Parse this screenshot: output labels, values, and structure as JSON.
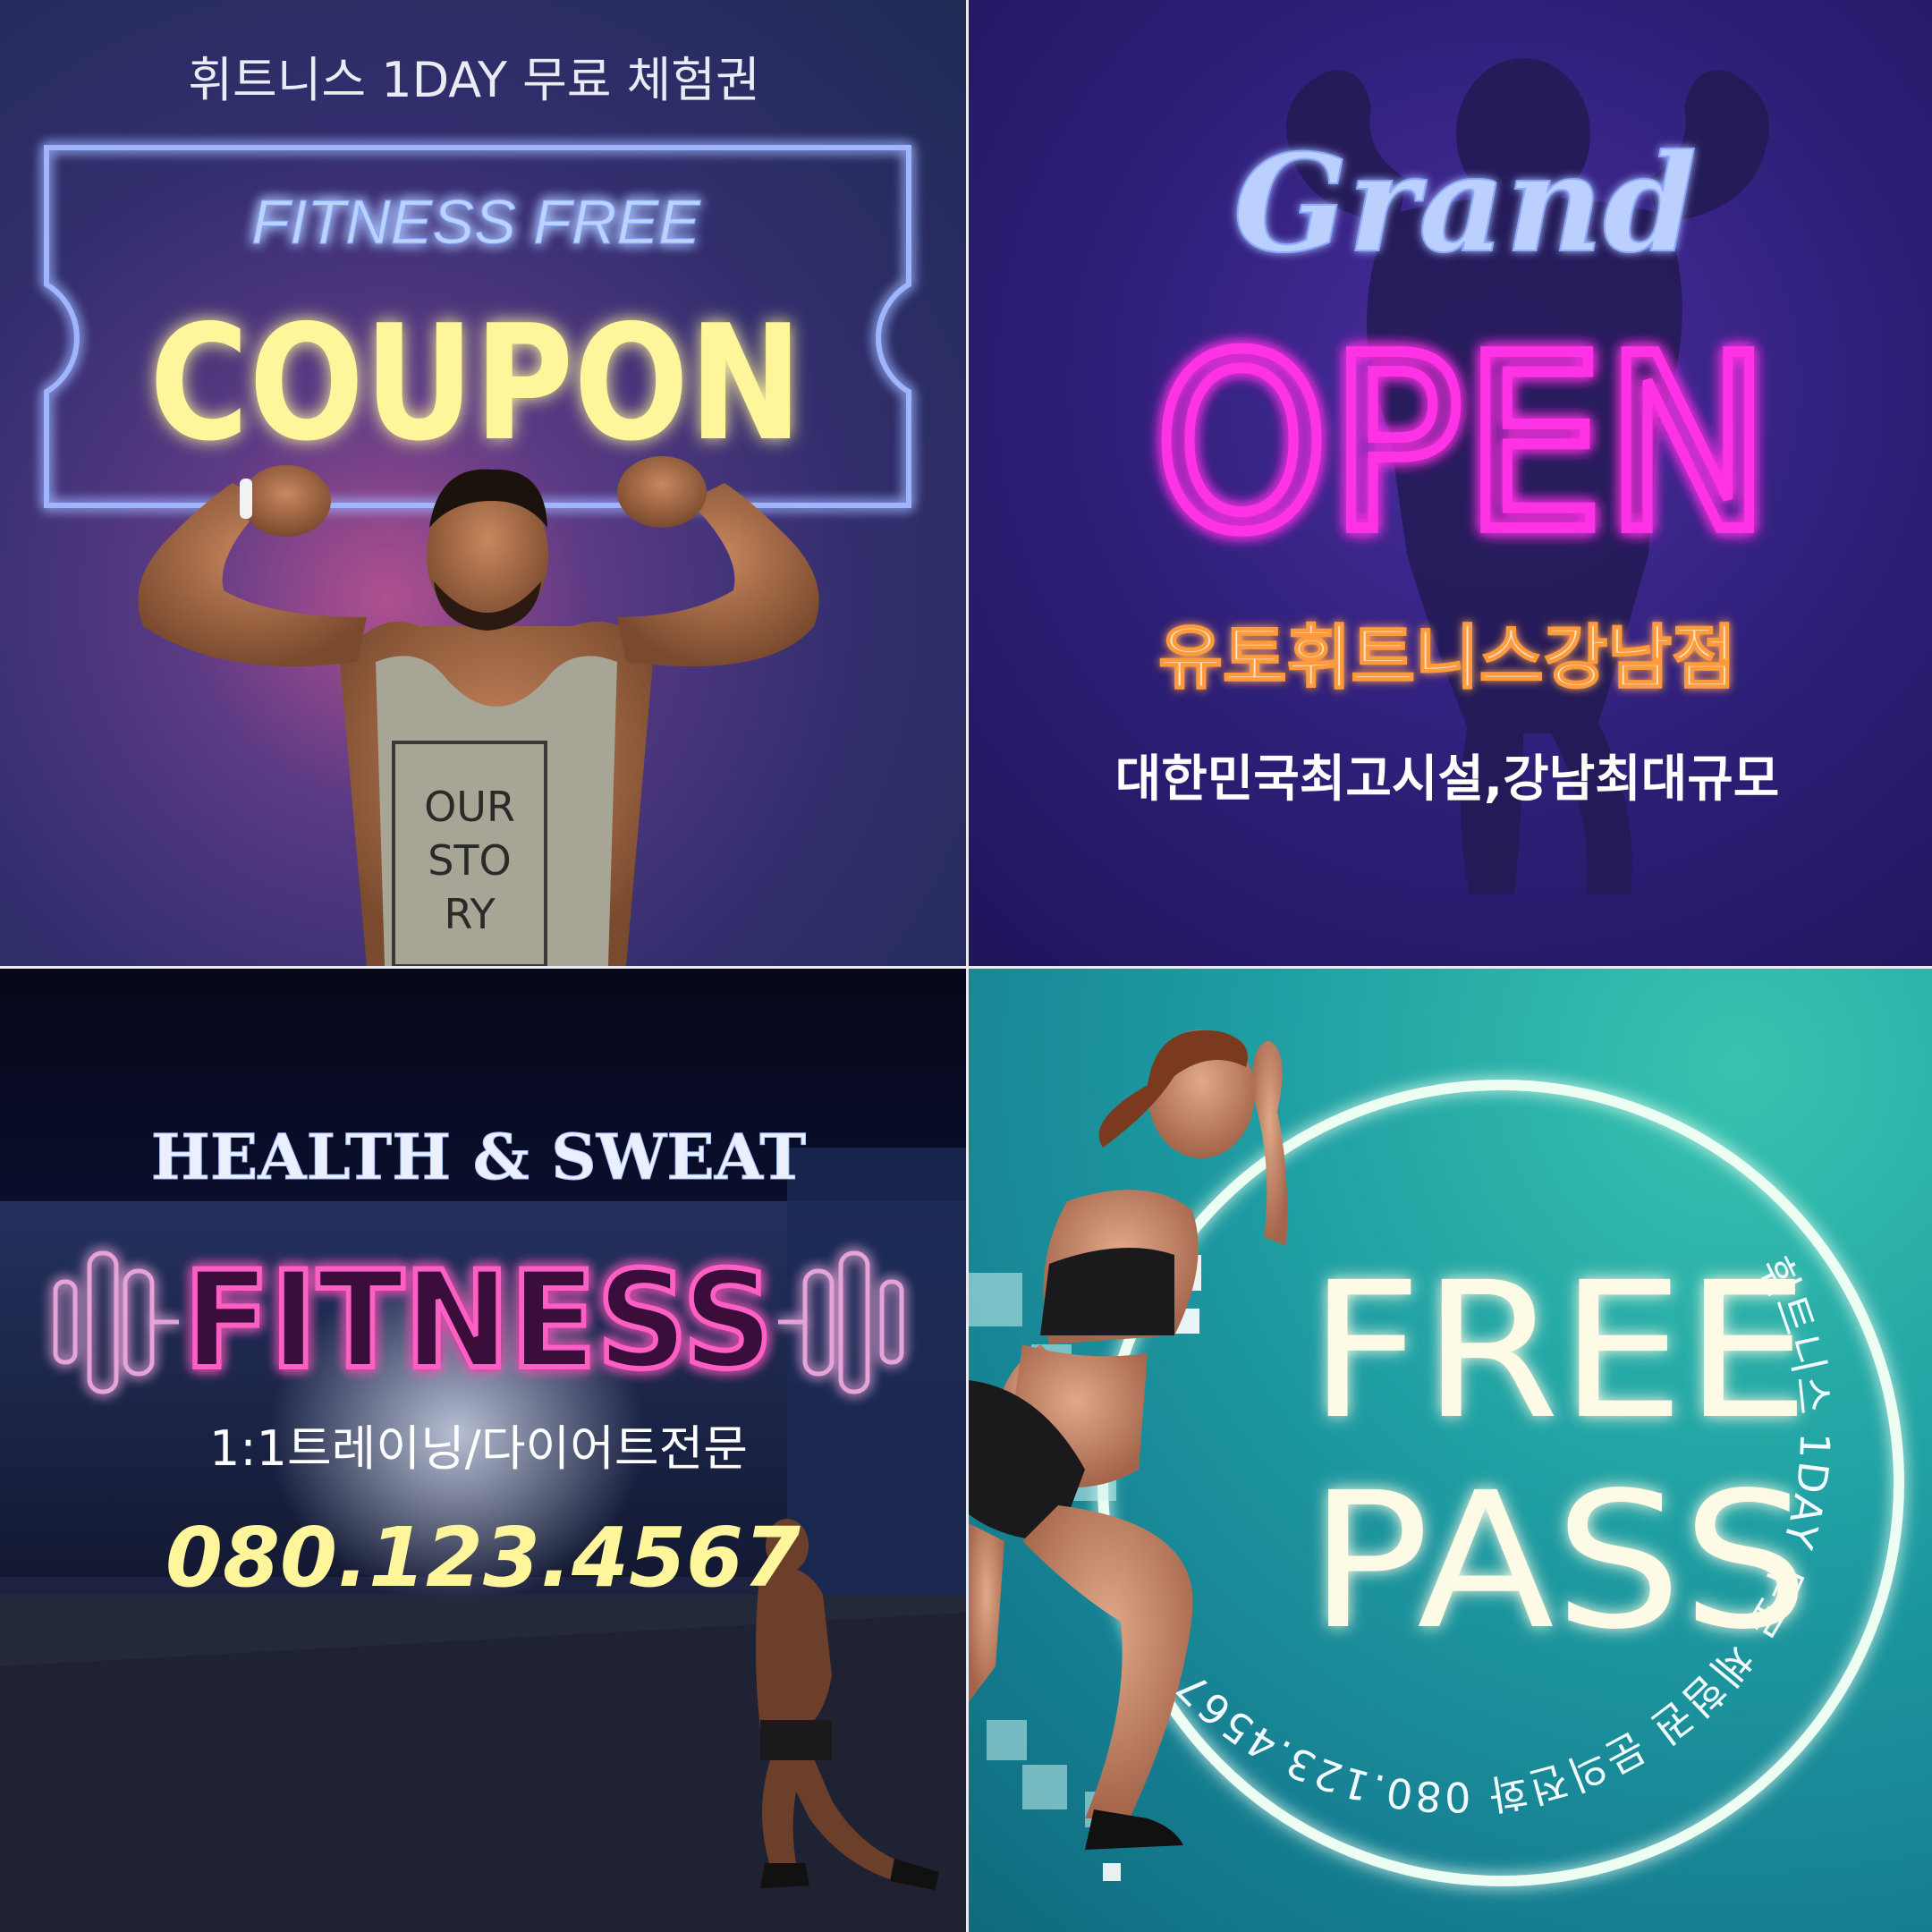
{
  "panel1": {
    "top_text": "휘트니스 1DAY 무료 체험권",
    "small_title": "FITNESS FREE",
    "big_title": "COUPON",
    "shirt_lines": [
      "OUR",
      "STO",
      "RY"
    ]
  },
  "panel2": {
    "script_title": "Grand",
    "big_title": "OPEN",
    "gym_name": "유토휘트니스강남점",
    "tagline": "대한민국최고시설,강남최대규모"
  },
  "panel3": {
    "headline": "HEALTH & SWEAT",
    "big_title": "FITNESS",
    "subtitle": "1:1트레이닝/다이어트전문",
    "phone": "080.123.4567"
  },
  "panel4": {
    "line1": "FREE",
    "line2": "PASS",
    "circle_text": "휘트니스 1DAY 무료 체험권 문의전화 080.123.4567"
  },
  "colors": {
    "neon_blue": "#8fb8ff",
    "neon_yellow": "#fff59a",
    "neon_magenta": "#ff33e6",
    "neon_orange": "#ffb36b",
    "neon_pink": "#ff5fc4",
    "cream": "#fdfbe6"
  }
}
